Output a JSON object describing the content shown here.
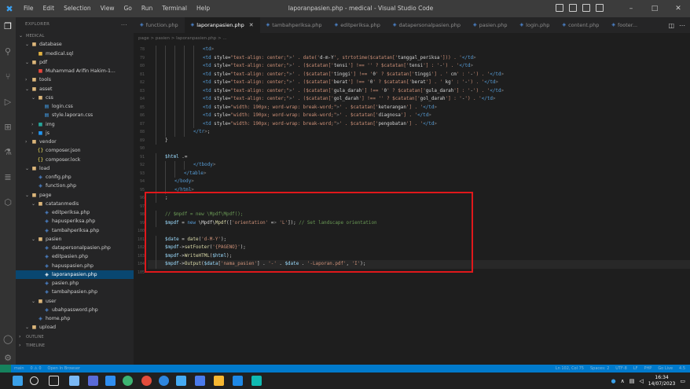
{
  "menu": [
    "File",
    "Edit",
    "Selection",
    "View",
    "Go",
    "Run",
    "Terminal",
    "Help"
  ],
  "window_title": "laporanpasien.php - medical - Visual Studio Code",
  "explorer": {
    "title": "EXPLORER",
    "tree": [
      {
        "label": "MEDICAL",
        "depth": 0,
        "kind": "section",
        "chev": "v"
      },
      {
        "label": "database",
        "depth": 1,
        "kind": "folder",
        "chev": "v"
      },
      {
        "label": "medical.sql",
        "depth": 2,
        "kind": "sql"
      },
      {
        "label": "pdf",
        "depth": 1,
        "kind": "folder",
        "chev": "v"
      },
      {
        "label": "Muhammad Arifin Hakim-1...",
        "depth": 2,
        "kind": "pdf"
      },
      {
        "label": "tools",
        "depth": 1,
        "kind": "folder",
        "chev": ">"
      },
      {
        "label": "asset",
        "depth": 1,
        "kind": "folder",
        "chev": "v"
      },
      {
        "label": "css",
        "depth": 2,
        "kind": "folder",
        "chev": "v"
      },
      {
        "label": "login.css",
        "depth": 3,
        "kind": "css"
      },
      {
        "label": "style.laporan.css",
        "depth": 3,
        "kind": "css"
      },
      {
        "label": "img",
        "depth": 2,
        "kind": "img",
        "chev": ">"
      },
      {
        "label": "js",
        "depth": 2,
        "kind": "js",
        "chev": ">"
      },
      {
        "label": "vendor",
        "depth": 1,
        "kind": "folder",
        "chev": ">"
      },
      {
        "label": "composer.json",
        "depth": 2,
        "kind": "json"
      },
      {
        "label": "composer.lock",
        "depth": 2,
        "kind": "json"
      },
      {
        "label": "load",
        "depth": 1,
        "kind": "folder",
        "chev": "v"
      },
      {
        "label": "config.php",
        "depth": 2,
        "kind": "php"
      },
      {
        "label": "function.php",
        "depth": 2,
        "kind": "php"
      },
      {
        "label": "page",
        "depth": 1,
        "kind": "folder",
        "chev": "v"
      },
      {
        "label": "catatanmedis",
        "depth": 2,
        "kind": "folder",
        "chev": "v"
      },
      {
        "label": "editperiksa.php",
        "depth": 3,
        "kind": "php"
      },
      {
        "label": "hapusperiksa.php",
        "depth": 3,
        "kind": "php"
      },
      {
        "label": "tambahperiksa.php",
        "depth": 3,
        "kind": "php"
      },
      {
        "label": "pasien",
        "depth": 2,
        "kind": "folder",
        "chev": "v"
      },
      {
        "label": "datapersonalpasien.php",
        "depth": 3,
        "kind": "php"
      },
      {
        "label": "editpasien.php",
        "depth": 3,
        "kind": "php"
      },
      {
        "label": "hapuspasien.php",
        "depth": 3,
        "kind": "php"
      },
      {
        "label": "laporanpasien.php",
        "depth": 3,
        "kind": "php",
        "selected": true
      },
      {
        "label": "pasien.php",
        "depth": 3,
        "kind": "php"
      },
      {
        "label": "tambahpasien.php",
        "depth": 3,
        "kind": "php"
      },
      {
        "label": "user",
        "depth": 2,
        "kind": "folder",
        "chev": "v"
      },
      {
        "label": "ubahpassword.php",
        "depth": 3,
        "kind": "php"
      },
      {
        "label": "home.php",
        "depth": 2,
        "kind": "php"
      },
      {
        "label": "upload",
        "depth": 1,
        "kind": "folder",
        "chev": "v"
      },
      {
        "label": "OUTLINE",
        "depth": 0,
        "kind": "section",
        "chev": ">"
      },
      {
        "label": "TIMELINE",
        "depth": 0,
        "kind": "section",
        "chev": ">"
      }
    ]
  },
  "tabs": [
    {
      "label": "function.php",
      "active": false
    },
    {
      "label": "laporanpasien.php",
      "active": true
    },
    {
      "label": "tambahperiksa.php",
      "active": false
    },
    {
      "label": "editperiksa.php",
      "active": false
    },
    {
      "label": "datapersonalpasien.php",
      "active": false
    },
    {
      "label": "pasien.php",
      "active": false
    },
    {
      "label": "login.php",
      "active": false
    },
    {
      "label": "content.php",
      "active": false
    },
    {
      "label": "footer...",
      "active": false
    }
  ],
  "breadcrumb": "page > pasien > laporanpasien.php > ...",
  "code_lines": [
    {
      "n": 78,
      "indent": 5,
      "text": "<td>"
    },
    {
      "n": 79,
      "indent": 5,
      "text": "<td style=\"text-align: center;\">' . date('d-m-Y', strtotime($catatan['tanggal_periksa'])) . '</td>"
    },
    {
      "n": 80,
      "indent": 5,
      "text": "<td style=\"text-align: center;\">' . ($catatan['tensi'] !== '' ? $catatan['tensi'] : '-') . '</td>"
    },
    {
      "n": 81,
      "indent": 5,
      "text": "<td style=\"text-align: center;\">' . ($catatan['tinggi'] !== '0' ? $catatan['tinggi'] . ' cm' : '-') . '</td>"
    },
    {
      "n": 82,
      "indent": 5,
      "text": "<td style=\"text-align: center;\">' . ($catatan['berat'] !== '0' ? $catatan['berat'] . ' kg' : '-') . '</td>"
    },
    {
      "n": 83,
      "indent": 5,
      "text": "<td style=\"text-align: center;\">' . ($catatan['gula_darah'] !== '0' ? $catatan['gula_darah'] : '-') . '</td>"
    },
    {
      "n": 84,
      "indent": 5,
      "text": "<td style=\"text-align: center;\">' . ($catatan['gol_darah'] !== '' ? $catatan['gol_darah'] : '-') . '</td>"
    },
    {
      "n": 85,
      "indent": 5,
      "text": "<td style=\"width: 190px; word-wrap: break-word;\">' . $catatan['keterangan'] . '</td>"
    },
    {
      "n": 86,
      "indent": 5,
      "text": "<td style=\"width: 190px; word-wrap: break-word;\">' . $catatan['diagnosa'] . '</td>"
    },
    {
      "n": 87,
      "indent": 5,
      "text": "<td style=\"width: 190px; word-wrap: break-word;\">' . $catatan['pengobatan'] . '</td>"
    },
    {
      "n": 88,
      "indent": 4,
      "text": "</tr>';"
    },
    {
      "n": 89,
      "indent": 1,
      "text": "}"
    },
    {
      "n": 90,
      "indent": 0,
      "text": ""
    },
    {
      "n": 91,
      "indent": 1,
      "text": "$html .= '"
    },
    {
      "n": 92,
      "indent": 4,
      "text": "</tbody>"
    },
    {
      "n": 93,
      "indent": 3,
      "text": "</table>"
    },
    {
      "n": 94,
      "indent": 2,
      "text": "</body>"
    },
    {
      "n": 95,
      "indent": 2,
      "text": "</html>"
    },
    {
      "n": 96,
      "indent": 1,
      "text": "';"
    },
    {
      "n": 97,
      "indent": 0,
      "text": ""
    },
    {
      "n": 98,
      "indent": 1,
      "text": "// $mpdf = new \\Mpdf\\Mpdf();"
    },
    {
      "n": 99,
      "indent": 1,
      "text": "$mpdf = new \\Mpdf\\Mpdf(['orientation' => 'L']); // Set landscape orientation"
    },
    {
      "n": 100,
      "indent": 0,
      "text": ""
    },
    {
      "n": 101,
      "indent": 1,
      "text": "$date = date('d-M-Y');"
    },
    {
      "n": 102,
      "indent": 1,
      "text": "$mpdf->setFooter('{PAGENO}');"
    },
    {
      "n": 103,
      "indent": 1,
      "text": "$mpdf->WriteHTML($html);"
    },
    {
      "n": 104,
      "indent": 1,
      "text": "$mpdf->Output($data['nama_pasien'] . '-' . $date . '-Laporan.pdf', 'I');"
    },
    {
      "n": 105,
      "indent": 0,
      "text": ""
    }
  ],
  "status": {
    "left": [
      "main",
      "0 ⚠ 0",
      "Open In Browser"
    ],
    "right": [
      "Ln 102, Col 75",
      "Spaces: 2",
      "UTF-8",
      "LF",
      "PHP",
      "Go Live",
      "4.5"
    ]
  },
  "clock": {
    "time": "16:34",
    "date": "14/07/2023"
  },
  "colors": {
    "accent": "#007acc",
    "highlight_box": "#e0181b",
    "selected_row": "#094771"
  }
}
